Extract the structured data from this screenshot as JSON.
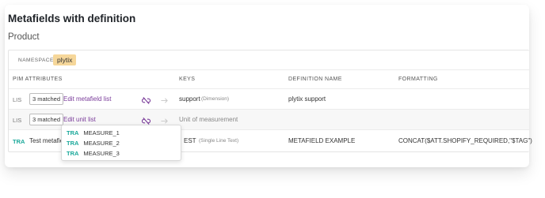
{
  "page": {
    "title": "Metafields with definition",
    "subtitle": "Product"
  },
  "namespace": {
    "label": "NAMESPACE",
    "value": "plytix"
  },
  "columns": {
    "pim_attributes": "PIM ATTRIBUTES",
    "keys": "KEYS",
    "definition_name": "DEFINITION NAME",
    "formatting": "FORMATTING"
  },
  "rows": [
    {
      "code": "LIS",
      "matched": "3 matched",
      "link": "Edit metafield list",
      "key": "support",
      "key_type": "(Dimension)",
      "definition": "plytix support",
      "formatting": ""
    },
    {
      "code": "LIS",
      "matched": "3 matched",
      "link": "Edit unit list",
      "key": "Unit of measurement",
      "key_type": "",
      "definition": "",
      "formatting": ""
    },
    {
      "code": "TRA",
      "attribute": "Test metafiel",
      "key": "EST",
      "key_type": "(Single Line Text)",
      "definition": "METAFIELD EXAMPLE",
      "formatting": "CONCAT($ATT.SHOPIFY_REQUIRED,\"$TAG\")"
    }
  ],
  "dropdown": {
    "items": [
      {
        "code": "TRA",
        "label": "MEASURE_1"
      },
      {
        "code": "TRA",
        "label": "MEASURE_2"
      },
      {
        "code": "TRA",
        "label": "MEASURE_3"
      }
    ]
  },
  "icons": {
    "unlink": "unlink-icon",
    "arrow": "arrow-right-icon"
  },
  "colors": {
    "link": "#7a3c9a",
    "teal": "#1aa89a",
    "chip": "#f6d79a"
  }
}
